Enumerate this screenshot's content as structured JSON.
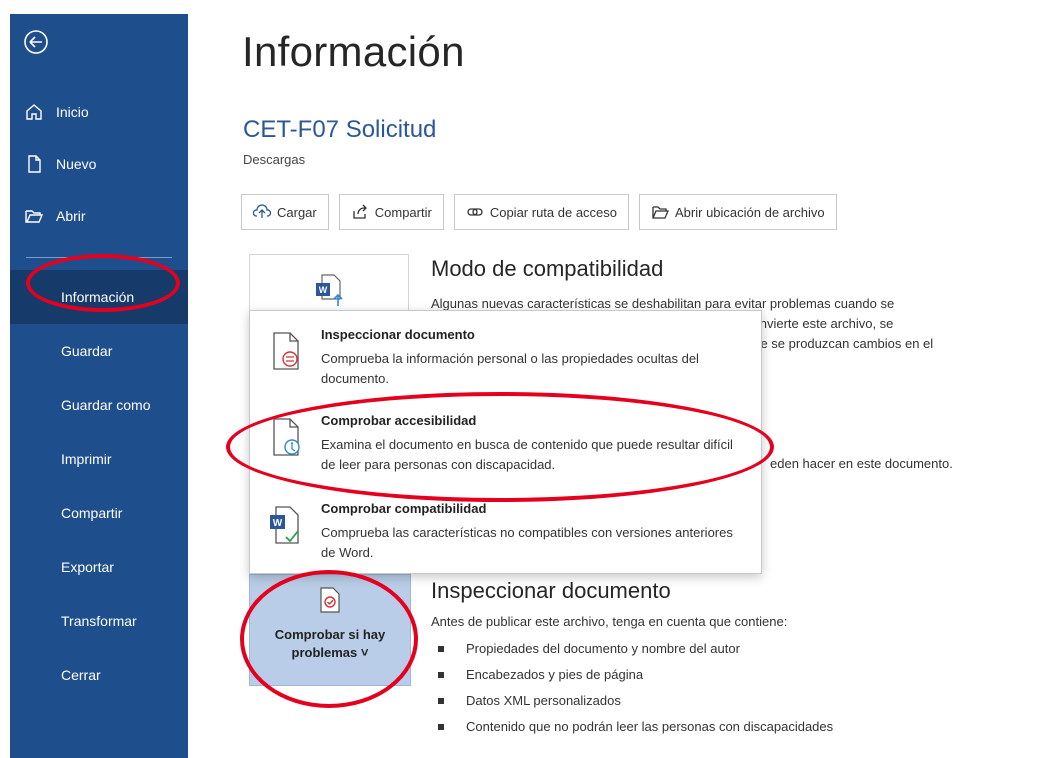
{
  "sidebar": {
    "back_label": "",
    "top_items": [
      {
        "label": "Inicio",
        "icon": "home-icon"
      },
      {
        "label": "Nuevo",
        "icon": "new-document-icon"
      },
      {
        "label": "Abrir",
        "icon": "open-folder-icon"
      }
    ],
    "items": [
      {
        "label": "Información",
        "active": true
      },
      {
        "label": "Guardar"
      },
      {
        "label": "Guardar como"
      },
      {
        "label": "Imprimir"
      },
      {
        "label": "Compartir"
      },
      {
        "label": "Exportar"
      },
      {
        "label": "Transformar"
      },
      {
        "label": "Cerrar"
      }
    ]
  },
  "main": {
    "title": "Información",
    "doc_title": "CET-F07 Solicitud",
    "doc_location": "Descargas",
    "actions": [
      {
        "label": "Cargar",
        "icon": "upload-icon"
      },
      {
        "label": "Compartir",
        "icon": "share-icon"
      },
      {
        "label": "Copiar ruta de acceso",
        "icon": "link-icon"
      },
      {
        "label": "Abrir ubicación de archivo",
        "icon": "folder-icon"
      }
    ],
    "compat": {
      "title": "Modo de compatibilidad",
      "description": "Algunas nuevas características se deshabilitan para evitar problemas cuando se convierte este archivo, se que se produzcan cambios en el",
      "desc_line1": "Algunas nuevas características se deshabilitan para evitar problemas cuando se",
      "desc_line2": "convierte este archivo, se",
      "desc_line3": "que se produzcan cambios en el"
    },
    "permissions_text": "eden hacer en este documento.",
    "inspect": {
      "button_label_1": "Comprobar si hay",
      "button_label_2": "problemas ˅",
      "title": "Inspeccionar documento",
      "description": "Antes de publicar este archivo, tenga en cuenta que contiene:",
      "items": [
        "Propiedades del documento y nombre del autor",
        "Encabezados y pies de página",
        "Datos XML personalizados",
        "Contenido que no podrán leer las personas con discapacidades"
      ]
    }
  },
  "menu": {
    "items": [
      {
        "title": "Inspeccionar documento",
        "description": "Comprueba la información personal o las propiedades ocultas del documento.",
        "icon": "inspect-document-icon"
      },
      {
        "title": "Comprobar accesibilidad",
        "description": "Examina el documento en busca de contenido que puede resultar difícil de leer para personas con discapacidad.",
        "icon": "accessibility-check-icon"
      },
      {
        "title": "Comprobar compatibilidad",
        "description": "Comprueba las características no compatibles con versiones anteriores de Word.",
        "icon": "compatibility-check-icon"
      }
    ]
  },
  "colors": {
    "sidebar": "#1e4e8c",
    "sidebar_active": "#163b6b",
    "accent_title": "#2b579a",
    "annotation": "#e5001e",
    "inspect_tile": "#b9cde8"
  }
}
